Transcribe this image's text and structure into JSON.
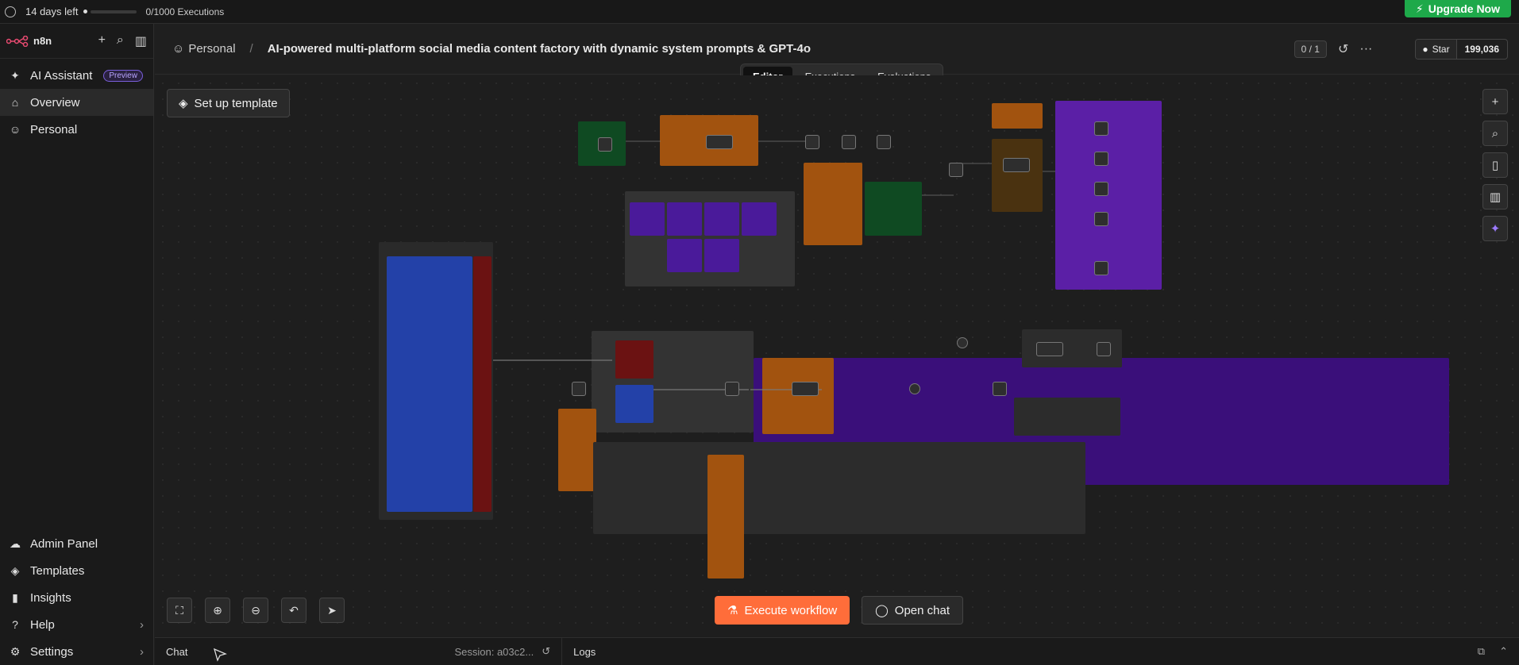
{
  "trial": {
    "days_left": "14 days left",
    "executions": "0/1000 Executions",
    "upgrade": "Upgrade Now"
  },
  "sidebar": {
    "brand": "n8n",
    "items": [
      {
        "label": "AI Assistant",
        "badge": "Preview",
        "icon": "sparkle-icon"
      },
      {
        "label": "Overview",
        "icon": "home-icon"
      },
      {
        "label": "Personal",
        "icon": "user-icon"
      }
    ],
    "bottom_items": [
      {
        "label": "Admin Panel",
        "icon": "cloud-icon"
      },
      {
        "label": "Templates",
        "icon": "box-icon"
      },
      {
        "label": "Insights",
        "icon": "chart-icon"
      },
      {
        "label": "Help",
        "icon": "help-icon"
      },
      {
        "label": "Settings",
        "icon": "gear-icon"
      }
    ]
  },
  "header": {
    "project": "Personal",
    "workflow_title": "AI-powered multi-platform social media content factory with dynamic system prompts & GPT-4o",
    "counter": "0 / 1",
    "github_star": "Star",
    "github_count": "199,036"
  },
  "tabs": [
    "Editor",
    "Executions",
    "Evaluations"
  ],
  "canvas": {
    "setup_template": "Set up template",
    "execute_workflow": "Execute workflow",
    "open_chat": "Open chat"
  },
  "logs": {
    "chat": "Chat",
    "session": "Session: a03c2...",
    "logs": "Logs"
  },
  "colors": {
    "orange": "#ff6d3a",
    "green": "#1ea94a",
    "purple": "#5b1fa6",
    "blue": "#2341a8",
    "maroon": "#6b1212"
  }
}
